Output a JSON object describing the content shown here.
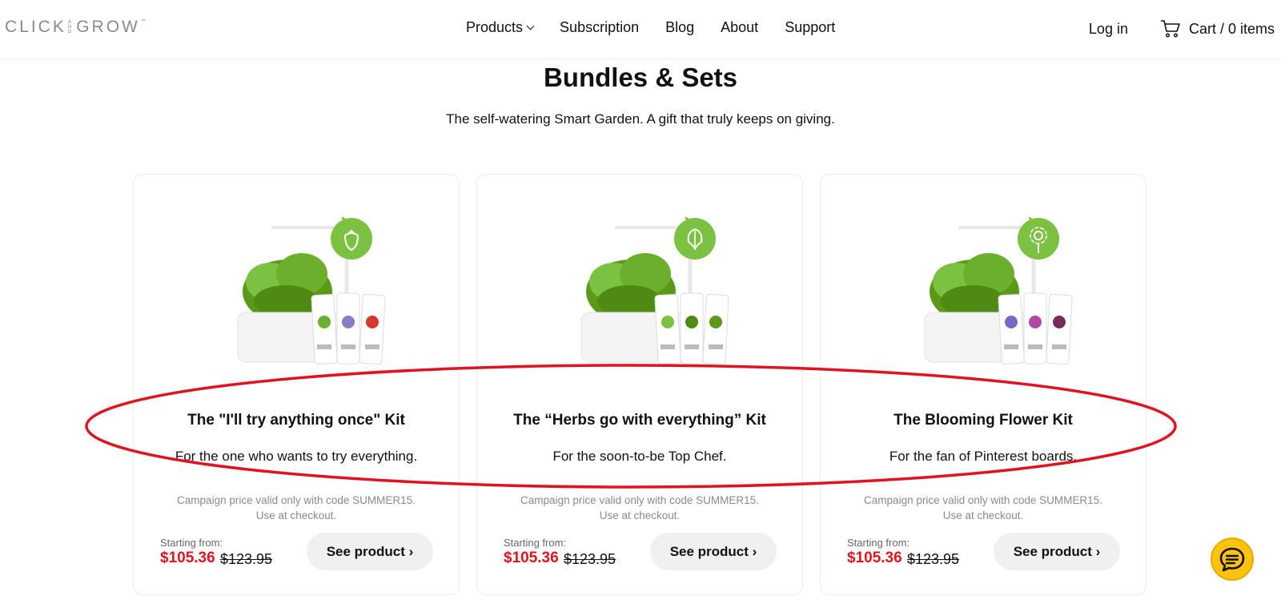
{
  "header": {
    "logo": {
      "left": "CLICK",
      "and_top": "AND",
      "right": "GROW",
      "tm": "™"
    },
    "nav": [
      "Products",
      "Subscription",
      "Blog",
      "About",
      "Support"
    ],
    "login": "Log in",
    "cart": "Cart / 0 items"
  },
  "page": {
    "title": "Bundles & Sets",
    "subtitle": "The self-watering Smart Garden. A gift that truly keeps on giving."
  },
  "cards": [
    {
      "title": "The \"I'll try anything once\" Kit",
      "desc": "For the one who wants to try everything.",
      "campaign_line1": "Campaign price valid only with code SUMMER15.",
      "campaign_line2": "Use at checkout.",
      "starting": "Starting from:",
      "price": "$105.36",
      "old_price": "$123.95",
      "button": "See product ›",
      "badge_icon": "strawberry-icon"
    },
    {
      "title": "The “Herbs go with everything” Kit",
      "desc": "For the soon-to-be Top Chef.",
      "campaign_line1": "Campaign price valid only with code SUMMER15.",
      "campaign_line2": "Use at checkout.",
      "starting": "Starting from:",
      "price": "$105.36",
      "old_price": "$123.95",
      "button": "See product ›",
      "badge_icon": "herb-leaf-icon"
    },
    {
      "title": "The Blooming Flower Kit",
      "desc": "For the fan of Pinterest boards.",
      "campaign_line1": "Campaign price valid only with code SUMMER15.",
      "campaign_line2": "Use at checkout.",
      "starting": "Starting from:",
      "price": "$105.36",
      "old_price": "$123.95",
      "button": "See product ›",
      "badge_icon": "flower-icon"
    }
  ],
  "colors": {
    "accent_green": "#7cc242",
    "sale_red": "#e8121e",
    "annotation_red": "#e0141e",
    "chat_yellow": "#ffc20e"
  }
}
